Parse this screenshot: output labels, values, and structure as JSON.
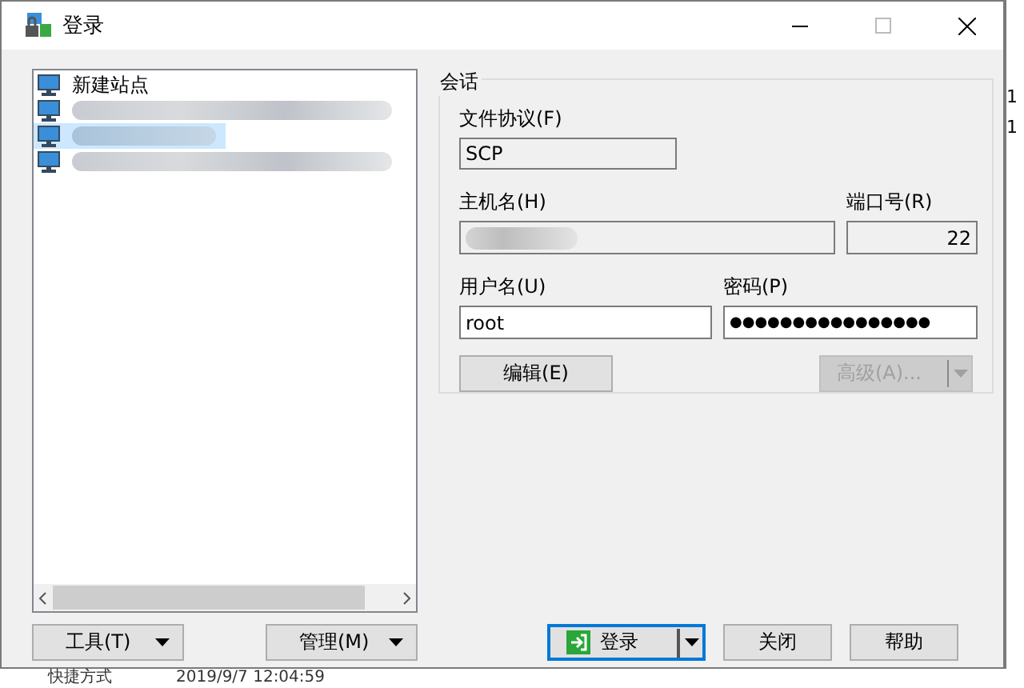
{
  "window": {
    "title": "登录"
  },
  "sites": [
    {
      "kind": "new-site",
      "label": "新建站点",
      "selected": false
    },
    {
      "kind": "site",
      "selected": false
    },
    {
      "kind": "site",
      "selected": true
    },
    {
      "kind": "site",
      "selected": false
    }
  ],
  "left_buttons": [
    {
      "label": "工具(T)"
    },
    {
      "label": "管理(M)"
    }
  ],
  "session": {
    "title": "会话",
    "protocol_label": "文件协议(F)",
    "protocol": "SCP",
    "host_label": "主机名(H)",
    "port_label": "端口号(R)",
    "port": "22",
    "user_label": "用户名(U)",
    "user": "root",
    "password_label": "密码(P)",
    "password": "●●●●●●●●●●●●●●●●",
    "edit_button": "编辑(E)",
    "advanced_button": {
      "label": "高级(A)...",
      "disabled": true
    }
  },
  "bottom_buttons": [
    {
      "label": "登录",
      "kind": "login-split"
    },
    {
      "label": "关闭",
      "kind": "plain"
    },
    {
      "label": "帮助",
      "kind": "plain"
    }
  ],
  "background_window": {
    "right_column": [
      "1",
      "1"
    ],
    "row": [
      "快捷方式",
      "2019/9/7  12:04:59"
    ]
  }
}
